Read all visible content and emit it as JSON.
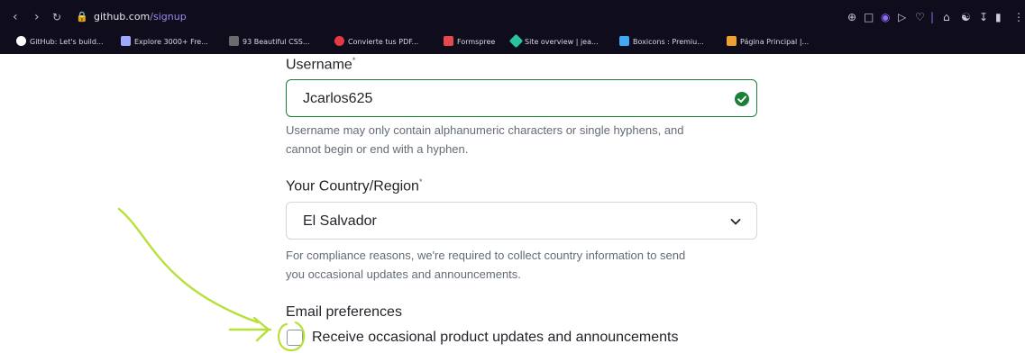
{
  "browser": {
    "url_host": "github.com",
    "url_path": "/signup",
    "bookmarks": [
      {
        "label": "GitHub: Let's build...",
        "color": "#ffffff"
      },
      {
        "label": "Explore 3000+ Fre...",
        "color": "#9fa8ff"
      },
      {
        "label": "93 Beautiful CSS...",
        "color": "#6b6b6b"
      },
      {
        "label": "Convierte tus PDF...",
        "color": "#e63946"
      },
      {
        "label": "Formspree",
        "color": "#e5484d"
      },
      {
        "label": "Site overview | jea...",
        "color": "#2ac3a2"
      },
      {
        "label": "Boxicons : Premiu...",
        "color": "#3fa9f5"
      },
      {
        "label": "Página Principal |...",
        "color": "#f0a030"
      }
    ]
  },
  "form": {
    "username": {
      "label": "Username",
      "required": "*",
      "value": "Jcarlos625",
      "hint_line1": "Username may only contain alphanumeric characters or single hyphens, and",
      "hint_line2": "cannot begin or end with a hyphen."
    },
    "country": {
      "label": "Your Country/Region",
      "required": "*",
      "value": "El Salvador",
      "hint_line1": "For compliance reasons, we're required to collect country information to send",
      "hint_line2": "you occasional updates and announcements."
    },
    "email_prefs": {
      "label": "Email preferences",
      "checkbox_label": "Receive occasional product updates and announcements"
    }
  },
  "colors": {
    "valid_border": "#1a7f37",
    "annotation": "#b7e03a"
  }
}
